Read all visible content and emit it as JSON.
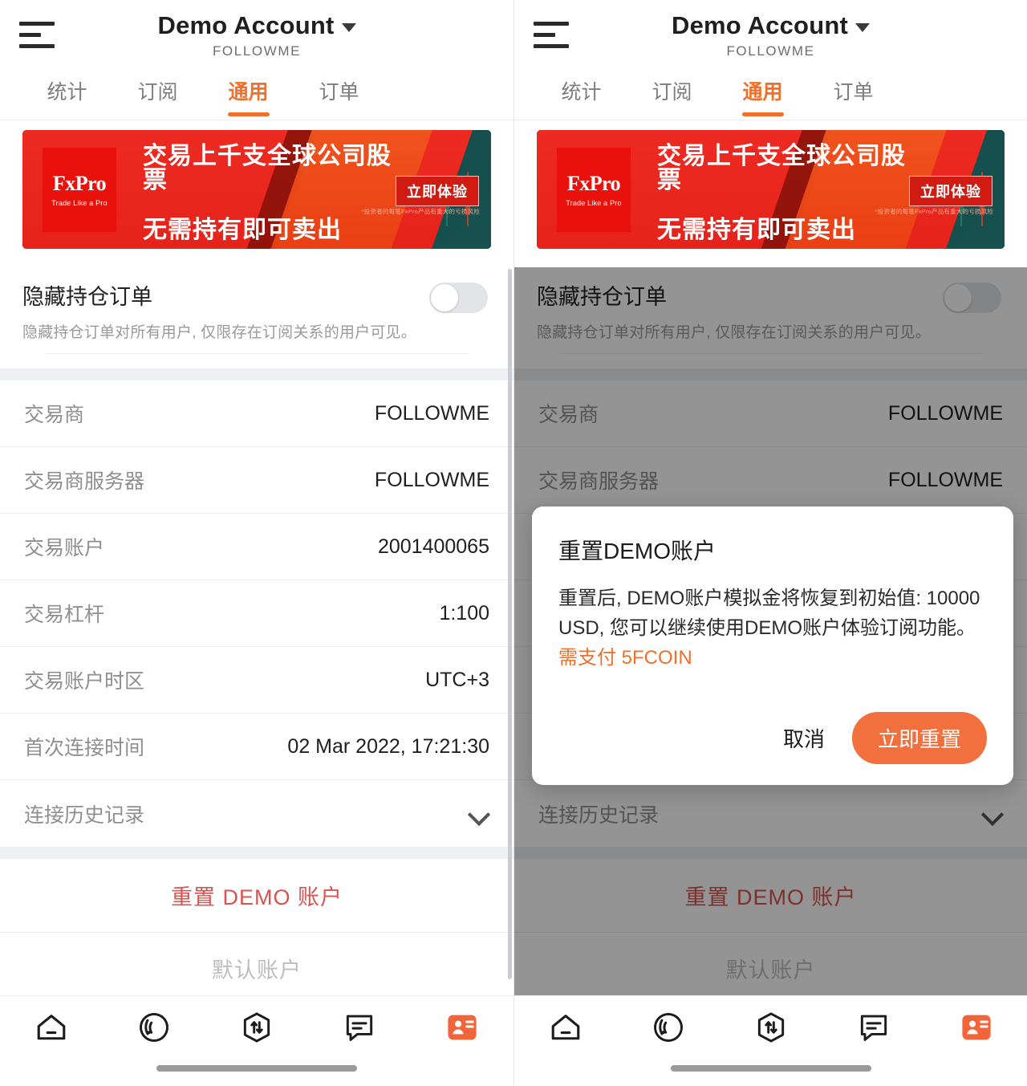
{
  "header": {
    "account_title": "Demo Account",
    "account_sub": "FOLLOWME",
    "menu_icon": "hamburger-icon",
    "caret_icon": "chevron-down-icon"
  },
  "tabs": [
    {
      "label": "统计",
      "active": false
    },
    {
      "label": "订阅",
      "active": false
    },
    {
      "label": "通用",
      "active": true
    },
    {
      "label": "订单",
      "active": false
    }
  ],
  "banner": {
    "brand": "FxPro",
    "brand_tagline": "Trade Like a Pro",
    "line1": "交易上千支全球公司股票",
    "line2": "无需持有即可卖出",
    "cta": "立即体验",
    "fine_print": "*投资者的每笔FxPro产品有重大的亏损风险"
  },
  "hide_setting": {
    "title": "隐藏持仓订单",
    "desc": "隐藏持仓订单对所有用户, 仅限存在订阅关系的用户可见。",
    "toggle_on": false
  },
  "info_rows": [
    {
      "label": "交易商",
      "value": "FOLLOWME"
    },
    {
      "label": "交易商服务器",
      "value": "FOLLOWME"
    },
    {
      "label": "交易账户",
      "value": "2001400065"
    },
    {
      "label": "交易杠杆",
      "value": "1:100"
    },
    {
      "label": "交易账户时区",
      "value": "UTC+3"
    },
    {
      "label": "首次连接时间",
      "value": "02 Mar 2022, 17:21:30"
    }
  ],
  "history_row": {
    "label": "连接历史记录",
    "icon": "chevron-down-icon"
  },
  "actions": {
    "reset_demo": "重置 DEMO 账户",
    "default_account": "默认账户"
  },
  "dialog": {
    "title": "重置DEMO账户",
    "body_plain": "重置后, DEMO账户模拟金将恢复到初始值: 10000 USD, 您可以继续使用DEMO账户体验订阅功能。",
    "body_highlight": "需支付 5FCOIN",
    "cancel": "取消",
    "confirm": "立即重置"
  },
  "bottom_nav": [
    {
      "name": "home-icon",
      "active": false
    },
    {
      "name": "signal-icon",
      "active": false
    },
    {
      "name": "trade-transfer-icon",
      "active": false
    },
    {
      "name": "message-icon",
      "active": false
    },
    {
      "name": "profile-card-icon",
      "active": true
    }
  ],
  "colors": {
    "accent": "#F0702A",
    "confirm_button": "#F2703E",
    "danger": "#D9534F",
    "banner_red": "#E8110B",
    "muted_text": "#8F8F8F"
  }
}
